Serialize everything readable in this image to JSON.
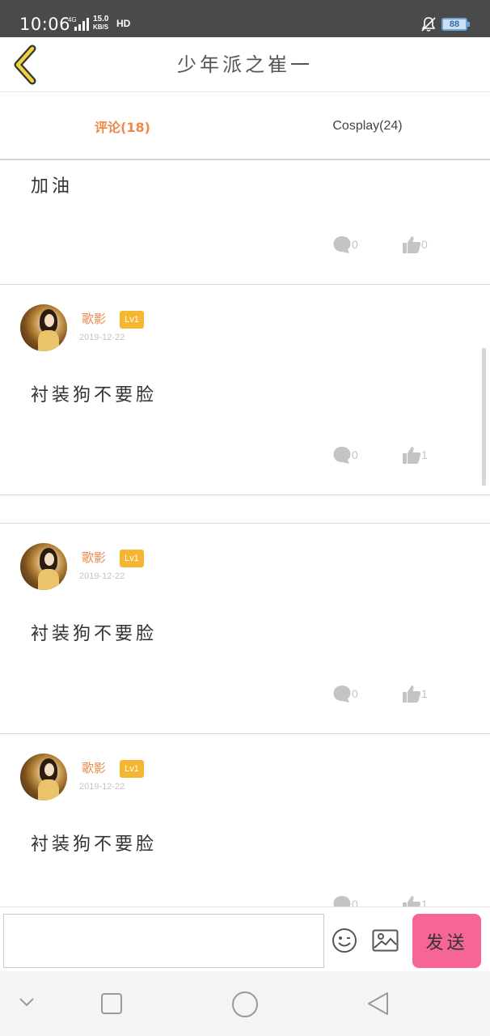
{
  "status_bar": {
    "time": "10:06",
    "network": "4G",
    "speed_value": "15.0",
    "speed_unit": "KB/S",
    "hd": "HD",
    "battery": "88"
  },
  "header": {
    "title": "少年派之崔一"
  },
  "tabs": [
    {
      "label": "评论(18)",
      "active": true
    },
    {
      "label": "Cosplay(24)",
      "active": false
    }
  ],
  "comments": [
    {
      "body": "加油",
      "replies": "0",
      "likes": "0"
    },
    {
      "username": "歌影",
      "level": "Lv1",
      "date": "2019-12-22",
      "body": "衬装狗不要脸",
      "replies": "0",
      "likes": "1"
    },
    {
      "username": "歌影",
      "level": "Lv1",
      "date": "2019-12-22",
      "body": "衬装狗不要脸",
      "replies": "0",
      "likes": "1"
    },
    {
      "username": "歌影",
      "level": "Lv1",
      "date": "2019-12-22",
      "body": "衬装狗不要脸",
      "replies": "0",
      "likes": "1"
    }
  ],
  "input_bar": {
    "placeholder": "",
    "send_label": "发送"
  },
  "colors": {
    "accent_orange": "#f0884a",
    "send_pink": "#f56597",
    "level_badge": "#f5b731"
  }
}
